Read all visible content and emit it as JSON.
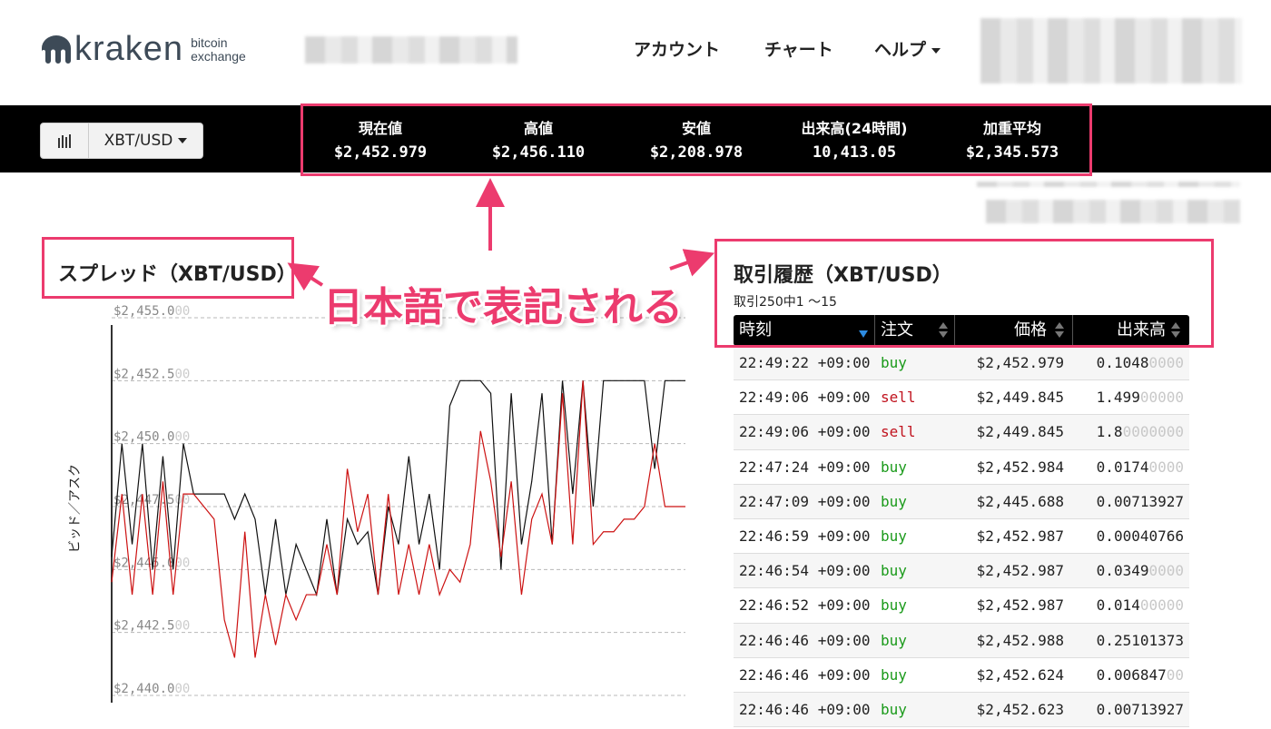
{
  "brand": {
    "name": "kraken",
    "tagline_line1": "bitcoin",
    "tagline_line2": "exchange",
    "color": "#3d4a57"
  },
  "nav": {
    "account": "アカウント",
    "chart": "チャート",
    "help": "ヘルプ"
  },
  "pair_selector": {
    "value": "XBT/USD",
    "icon": "bar-chart-icon"
  },
  "ticker": [
    {
      "label": "現在値",
      "value": "$2,452.979"
    },
    {
      "label": "高値",
      "value": "$2,456.110"
    },
    {
      "label": "安値",
      "value": "$2,208.978"
    },
    {
      "label": "出来高(24時間)",
      "value": "10,413.05"
    },
    {
      "label": "加重平均",
      "value": "$2,345.573"
    }
  ],
  "annotation": {
    "text": "日本語で表記される",
    "color": "#ec3b6e"
  },
  "spread": {
    "title": "スプレッド（XBT/USD）",
    "y_title": "ビッド／アスク"
  },
  "chart_data": {
    "type": "line",
    "title": "スプレッド（XBT/USD）",
    "ylabel": "ビッド／アスク",
    "ylim": [
      2440.0,
      2455.0
    ],
    "ytick_labels": [
      "$2,455.000",
      "$2,452.500",
      "$2,450.000",
      "$2,447.500",
      "$2,445.000",
      "$2,442.500",
      "$2,440.000"
    ],
    "ytick_values": [
      2455.0,
      2452.5,
      2450.0,
      2447.5,
      2445.0,
      2442.5,
      2440.0
    ],
    "grid": true,
    "series": [
      {
        "color": "#111111",
        "values": [
          2445.5,
          2450.0,
          2446.0,
          2450.0,
          2445.0,
          2449.5,
          2445.0,
          2450.0,
          2448.0,
          2448.0,
          2448.0,
          2448.0,
          2447.0,
          2448.0,
          2447.0,
          2444.0,
          2447.0,
          2444.0,
          2446.0,
          2445.0,
          2444.0,
          2447.0,
          2444.0,
          2447.0,
          2446.0,
          2446.5,
          2444.0,
          2447.5,
          2446.0,
          2449.5,
          2446.0,
          2448.0,
          2445.0,
          2451.5,
          2452.5,
          2452.5,
          2452.5,
          2452.0,
          2445.0,
          2452.0,
          2446.0,
          2448.5,
          2452.0,
          2446.0,
          2452.5,
          2448.0,
          2452.5,
          2447.5,
          2452.5,
          2452.5,
          2452.5,
          2452.5,
          2452.5,
          2449.0,
          2452.5,
          2452.5,
          2452.5
        ]
      },
      {
        "color": "#cc1111",
        "values": [
          2444.5,
          2448.0,
          2444.0,
          2448.0,
          2444.0,
          2448.5,
          2444.0,
          2448.0,
          2448.0,
          2447.5,
          2447.0,
          2443.0,
          2441.5,
          2446.5,
          2441.5,
          2444.0,
          2442.0,
          2444.0,
          2443.0,
          2444.0,
          2444.0,
          2446.0,
          2444.0,
          2449.0,
          2446.5,
          2448.0,
          2444.0,
          2448.0,
          2444.0,
          2446.0,
          2444.0,
          2446.0,
          2444.0,
          2445.0,
          2444.5,
          2446.0,
          2450.5,
          2448.5,
          2445.5,
          2448.5,
          2444.0,
          2447.0,
          2448.0,
          2446.0,
          2452.0,
          2446.0,
          2452.5,
          2446.0,
          2446.5,
          2446.5,
          2447.0,
          2447.0,
          2447.5,
          2450.0,
          2447.5,
          2447.5,
          2447.5
        ]
      }
    ]
  },
  "trades": {
    "title": "取引履歴（XBT/USD）",
    "subtitle": "取引250中1 〜15",
    "columns": {
      "time": "時刻",
      "order": "注文",
      "price": "価格",
      "volume": "出来高"
    },
    "rows": [
      {
        "time": "22:49:22 +09:00",
        "side": "buy",
        "price": "$2,452.979",
        "vol_main": "0.1048",
        "vol_dim": "0000"
      },
      {
        "time": "22:49:06 +09:00",
        "side": "sell",
        "price": "$2,449.845",
        "vol_main": "1.499",
        "vol_dim": "00000"
      },
      {
        "time": "22:49:06 +09:00",
        "side": "sell",
        "price": "$2,449.845",
        "vol_main": "1.8",
        "vol_dim": "0000000"
      },
      {
        "time": "22:47:24 +09:00",
        "side": "buy",
        "price": "$2,452.984",
        "vol_main": "0.0174",
        "vol_dim": "0000"
      },
      {
        "time": "22:47:09 +09:00",
        "side": "buy",
        "price": "$2,445.688",
        "vol_main": "0.00713927",
        "vol_dim": ""
      },
      {
        "time": "22:46:59 +09:00",
        "side": "buy",
        "price": "$2,452.987",
        "vol_main": "0.00040766",
        "vol_dim": ""
      },
      {
        "time": "22:46:54 +09:00",
        "side": "buy",
        "price": "$2,452.987",
        "vol_main": "0.0349",
        "vol_dim": "0000"
      },
      {
        "time": "22:46:52 +09:00",
        "side": "buy",
        "price": "$2,452.987",
        "vol_main": "0.014",
        "vol_dim": "00000"
      },
      {
        "time": "22:46:46 +09:00",
        "side": "buy",
        "price": "$2,452.988",
        "vol_main": "0.25101373",
        "vol_dim": ""
      },
      {
        "time": "22:46:46 +09:00",
        "side": "buy",
        "price": "$2,452.624",
        "vol_main": "0.006847",
        "vol_dim": "00"
      },
      {
        "time": "22:46:46 +09:00",
        "side": "buy",
        "price": "$2,452.623",
        "vol_main": "0.00713927",
        "vol_dim": ""
      }
    ]
  }
}
